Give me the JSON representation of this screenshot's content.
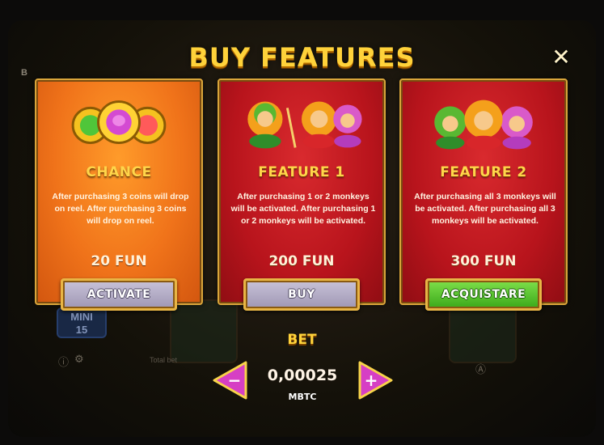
{
  "popup": {
    "title": "BUY FEATURES",
    "close_symbol": "✕"
  },
  "cards": [
    {
      "title": "CHANCE",
      "description": "After purchasing 3 coins will drop on reel.  After purchasing 3 coins will drop on reel.",
      "price": "20 FUN",
      "button_label": "ACTIVATE",
      "button_style": "grey",
      "art": "coins-icon"
    },
    {
      "title": "FEATURE 1",
      "description": "After purchasing 1 or 2 monkeys will be activated. After purchasing 1 or 2 monkeys will be activated.",
      "price": "200 FUN",
      "button_label": "BUY",
      "button_style": "grey",
      "art": "monkeys-pair-icon"
    },
    {
      "title": "FEATURE 2",
      "description": "After purchasing all 3 monkeys will be activated. After purchasing all 3 monkeys will be activated.",
      "price": "300 FUN",
      "button_label": "ACQUISTARE",
      "button_style": "green",
      "art": "monkeys-trio-icon"
    }
  ],
  "bet": {
    "label": "BET",
    "value": "0,00025",
    "unit": "MBTC",
    "decrease_symbol": "−",
    "increase_symbol": "+"
  },
  "background": {
    "badge_top": "MINI",
    "badge_value": "15",
    "total_bet_label": "Total bet",
    "corner_letter": "B"
  },
  "colors": {
    "title_gold": "#ffd23a",
    "card_orange": "#f0731a",
    "card_red": "#b8141c",
    "button_grey": "#b3acc6",
    "button_green": "#4cbc26",
    "arrow_magenta": "#d63fc4"
  }
}
